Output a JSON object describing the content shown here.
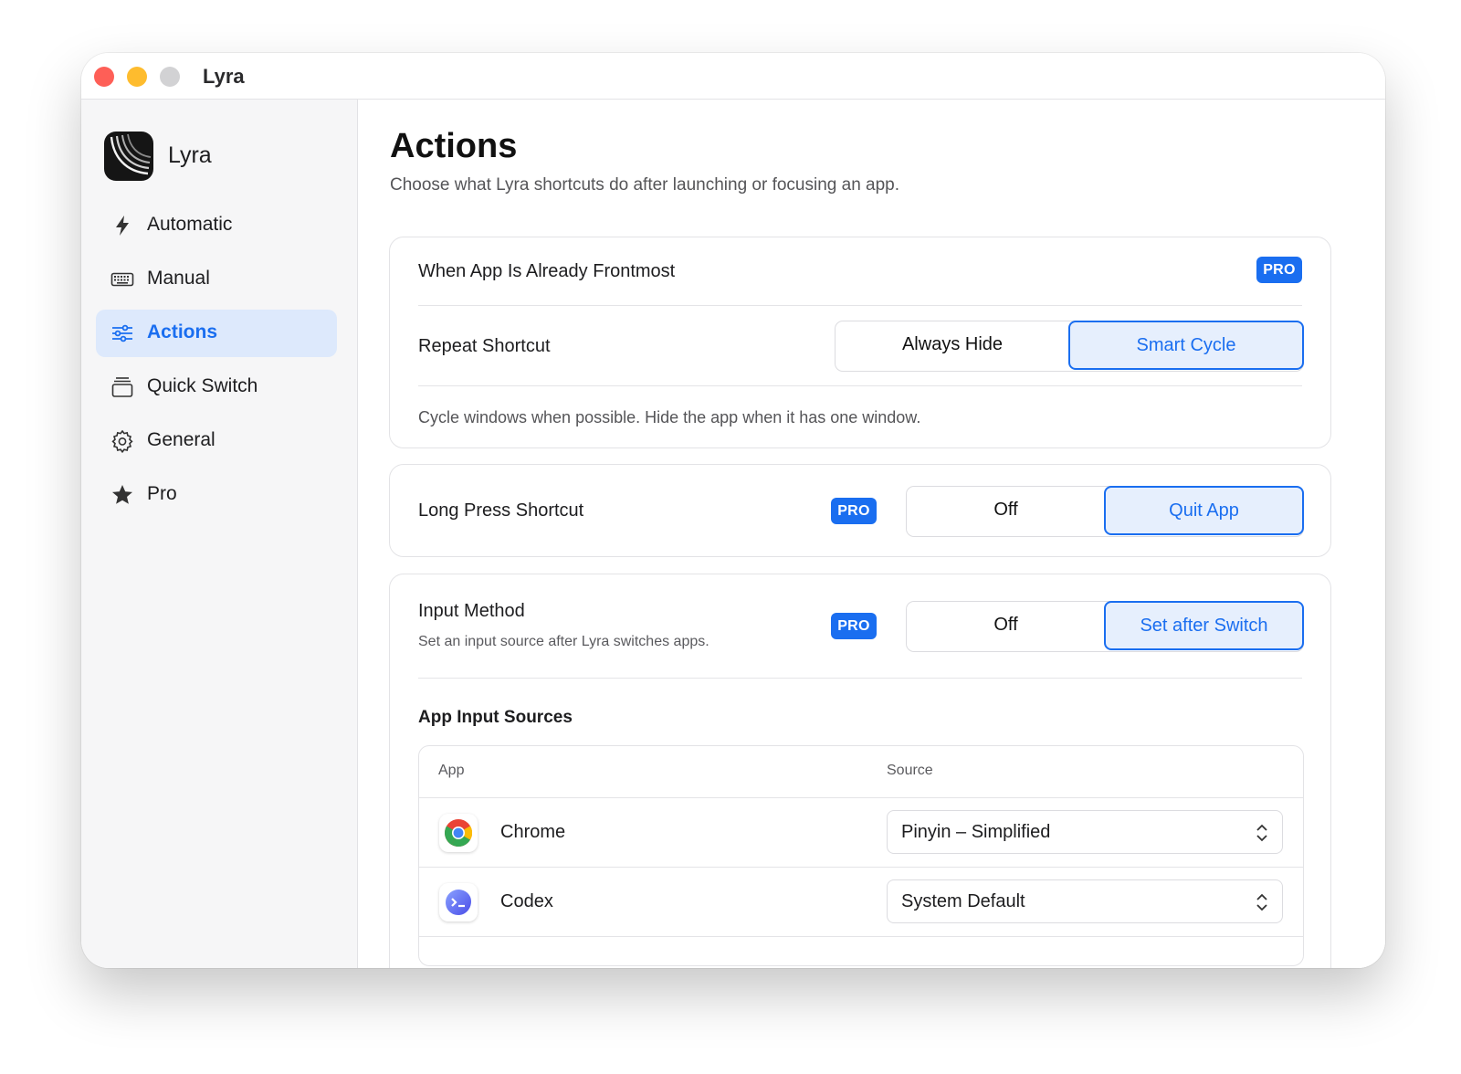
{
  "window": {
    "title": "Lyra"
  },
  "sidebar": {
    "app_name": "Lyra",
    "items": [
      {
        "label": "Automatic",
        "icon": "bolt-icon"
      },
      {
        "label": "Manual",
        "icon": "keyboard-icon"
      },
      {
        "label": "Actions",
        "icon": "sliders-icon",
        "selected": true
      },
      {
        "label": "Quick Switch",
        "icon": "window-stack-icon"
      },
      {
        "label": "General",
        "icon": "gear-icon"
      },
      {
        "label": "Pro",
        "icon": "star-icon"
      }
    ]
  },
  "page": {
    "title": "Actions",
    "subtitle": "Choose what Lyra shortcuts do after launching or focusing an app."
  },
  "frontmost_card": {
    "heading": "When App Is Already Frontmost",
    "badge": "PRO",
    "repeat_label": "Repeat Shortcut",
    "options": [
      "Always Hide",
      "Smart Cycle"
    ],
    "selected_option": "Smart Cycle",
    "description": "Cycle windows when possible. Hide the app when it has one window."
  },
  "long_press_card": {
    "label": "Long Press Shortcut",
    "badge": "PRO",
    "options": [
      "Off",
      "Quit App"
    ],
    "selected_option": "Quit App"
  },
  "input_method_card": {
    "label": "Input Method",
    "description": "Set an input source after Lyra switches apps.",
    "badge": "PRO",
    "options": [
      "Off",
      "Set after Switch"
    ],
    "selected_option": "Set after Switch",
    "table_title": "App Input Sources",
    "columns": [
      "App",
      "Source"
    ],
    "rows": [
      {
        "app": "Chrome",
        "source": "Pinyin – Simplified",
        "icon": "chrome-icon"
      },
      {
        "app": "Codex",
        "source": "System Default",
        "icon": "codex-icon"
      }
    ]
  },
  "colors": {
    "accent": "#1a6ef0",
    "selected_bg": "#e6effd",
    "sidebar_bg": "#f6f6f7"
  }
}
